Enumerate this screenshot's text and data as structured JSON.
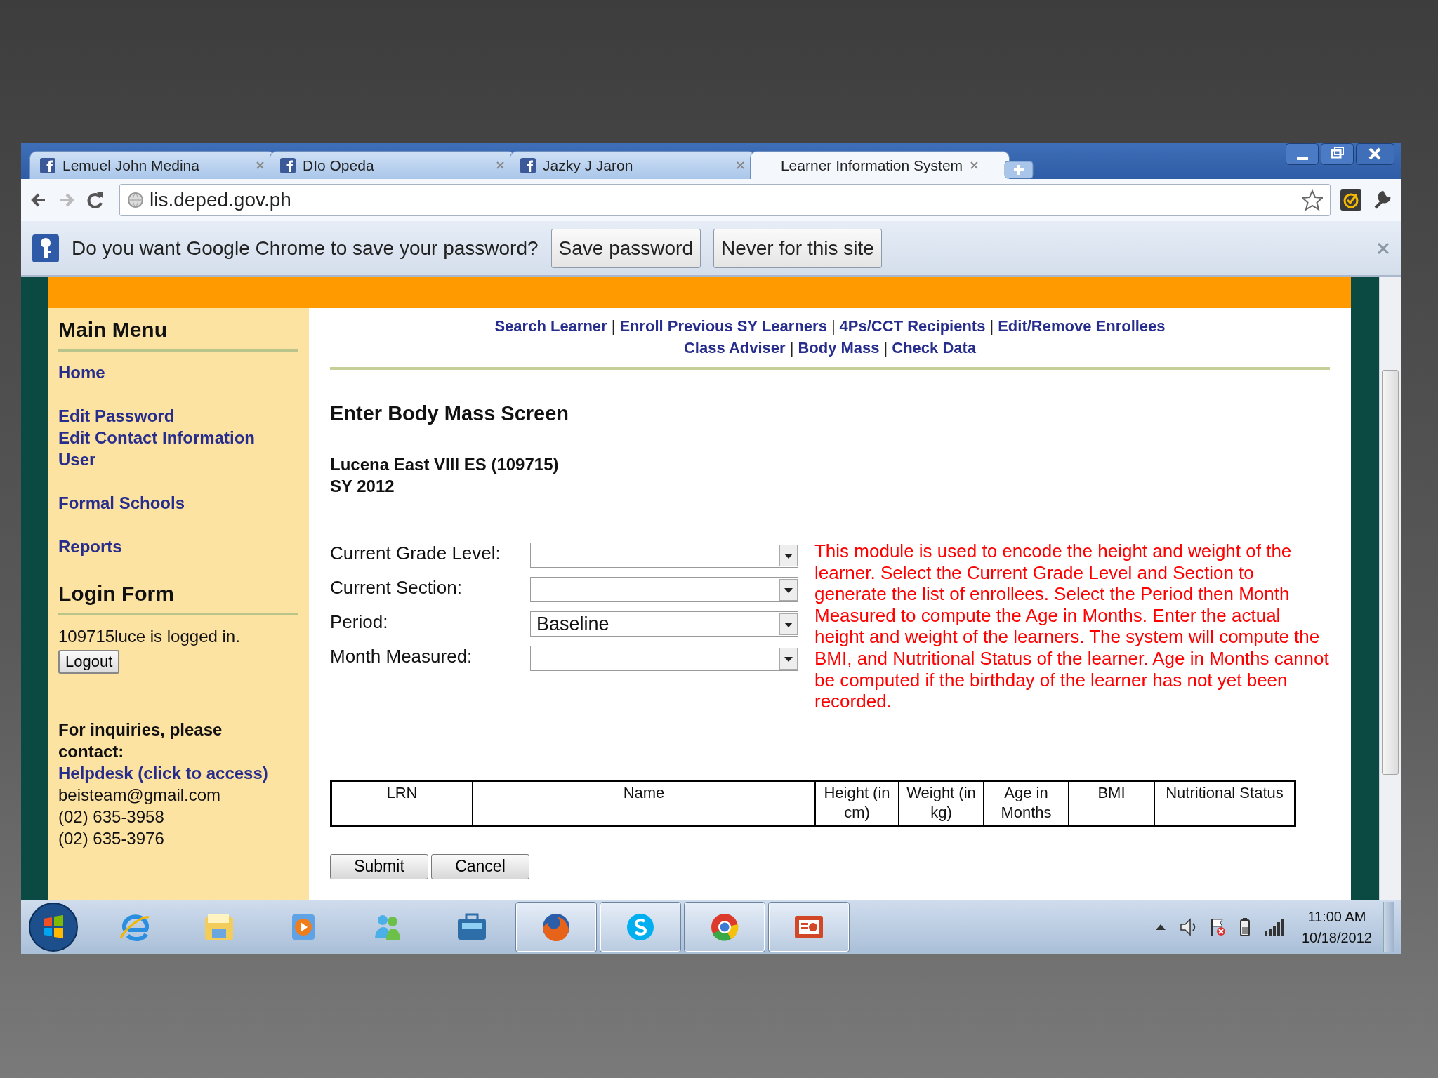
{
  "browser": {
    "tabs": [
      {
        "label": "Lemuel John Medina",
        "selected": false,
        "favicon": true
      },
      {
        "label": "DIo Opeda",
        "selected": false,
        "favicon": true
      },
      {
        "label": "Jazky J Jaron",
        "selected": false,
        "favicon": true
      },
      {
        "label": "Learner Information System",
        "selected": true,
        "favicon": false
      }
    ],
    "address": "lis.deped.gov.ph",
    "password_bar": {
      "question": "Do you want Google Chrome to save your password?",
      "buttons": [
        "Save password",
        "Never for this site"
      ]
    }
  },
  "sidebar": {
    "main_menu": {
      "title": "Main Menu",
      "groups": [
        [
          "Home"
        ],
        [
          "Edit Password",
          "Edit Contact Information",
          "User"
        ],
        [
          "Formal Schools"
        ],
        [
          "Reports"
        ]
      ]
    },
    "login_form": {
      "title": "Login Form",
      "status": "109715luce is logged in.",
      "button": "Logout"
    },
    "contact": {
      "heading": "For inquiries, please contact:",
      "link": "Helpdesk (click to access)",
      "lines": [
        "beisteam@gmail.com",
        "(02) 635-3958",
        "(02) 635-3976"
      ]
    }
  },
  "content": {
    "nav_rows": [
      [
        "Search Learner",
        "Enroll Previous SY Learners",
        "4Ps/CCT Recipients",
        "Edit/Remove Enrollees"
      ],
      [
        "Class Adviser",
        "Body Mass",
        "Check Data"
      ]
    ],
    "separator": "|",
    "title": "Enter Body Mass Screen",
    "school": "Lucena East VIII ES (109715)",
    "school_year": "SY 2012",
    "fields": [
      {
        "label": "Current Grade Level:"
      },
      {
        "label": "Current Section:"
      },
      {
        "label": "Period:",
        "value": "Baseline"
      },
      {
        "label": "Month Measured:"
      }
    ],
    "note": "This module is used to encode the height and weight of the learner. Select the Current Grade Level and Section to generate the list of enrollees. Select the Period then Month Measured to compute the Age in Months. Enter the actual height and weight of the learners. The system will compute the BMI, and Nutritional Status of the learner. Age in Months cannot be computed if the birthday of the learner has not yet been recorded.",
    "table": {
      "columns": [
        "LRN",
        "Name",
        "Height (in cm)",
        "Weight (in kg)",
        "Age in Months",
        "BMI",
        "Nutritional Status"
      ]
    },
    "buttons": [
      "Submit",
      "Cancel"
    ]
  },
  "taskbar": {
    "apps": [
      {
        "kind": "ie",
        "open": false
      },
      {
        "kind": "explorer",
        "open": false
      },
      {
        "kind": "media",
        "open": false
      },
      {
        "kind": "messenger",
        "open": false
      },
      {
        "kind": "briefcase",
        "open": false
      },
      {
        "kind": "firefox",
        "open": true
      },
      {
        "kind": "skype",
        "open": true
      },
      {
        "kind": "chrome",
        "open": true
      },
      {
        "kind": "powerpoint",
        "open": true
      }
    ],
    "time": "11:00 AM",
    "date": "10/18/2012"
  }
}
